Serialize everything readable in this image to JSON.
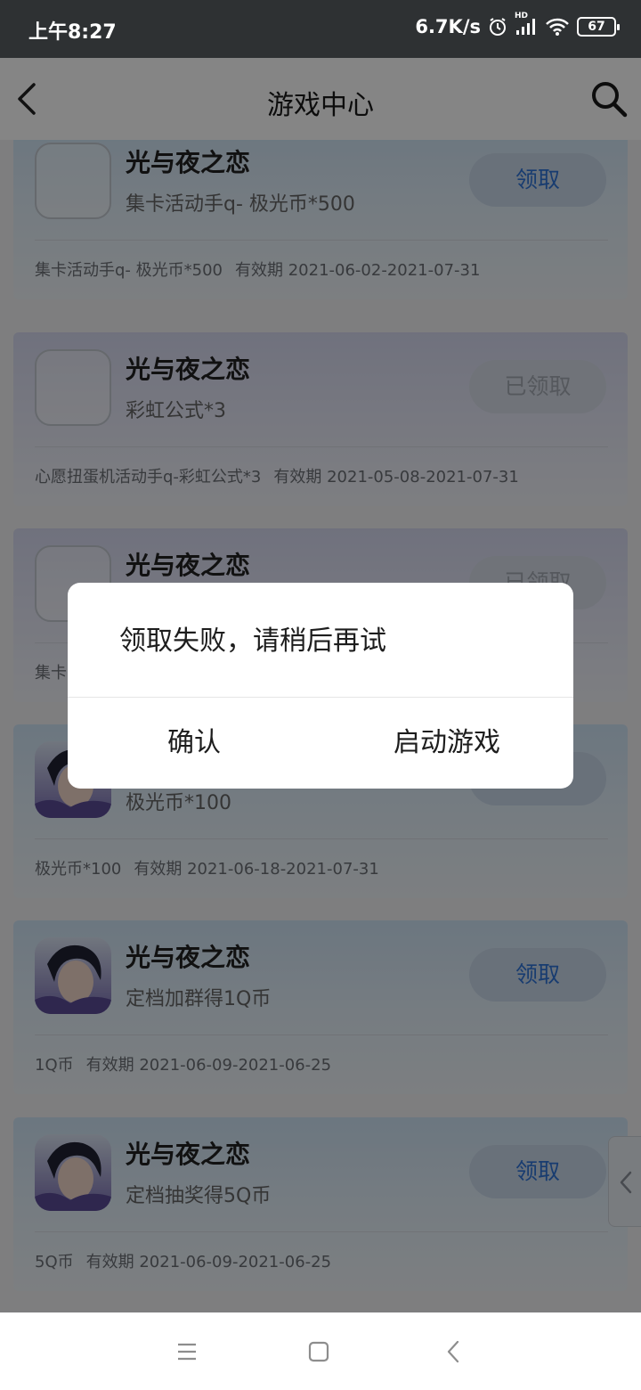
{
  "status_bar": {
    "time": "上午8:27",
    "net_speed": "6.7K/s",
    "battery": "67",
    "network_badge": "HD",
    "icons": [
      "alarm-icon",
      "signal-icon",
      "wifi-icon",
      "battery-icon"
    ]
  },
  "header": {
    "title": "游戏中心",
    "back_icon": "back-arrow-icon",
    "search_icon": "search-icon"
  },
  "cards": [
    {
      "title": "光与夜之恋",
      "subtitle": "集卡活动手q- 极光币*500",
      "button": "领取",
      "claimed": false,
      "icon_loaded": false,
      "desc": "集卡活动手q- 极光币*500",
      "validity": "有效期 2021-06-02-2021-07-31"
    },
    {
      "title": "光与夜之恋",
      "subtitle": "彩虹公式*3",
      "button": "已领取",
      "claimed": true,
      "icon_loaded": false,
      "desc": "心愿扭蛋机活动手q-彩虹公式*3",
      "validity": "有效期 2021-05-08-2021-07-31"
    },
    {
      "title": "光与夜之恋",
      "subtitle": "",
      "button": "已领取",
      "claimed": true,
      "icon_loaded": false,
      "desc": "集卡",
      "validity": ""
    },
    {
      "title": "",
      "subtitle": "极光币*100",
      "button": "领取",
      "claimed": false,
      "icon_loaded": true,
      "desc": "极光币*100",
      "validity": "有效期 2021-06-18-2021-07-31"
    },
    {
      "title": "光与夜之恋",
      "subtitle": "定档加群得1Q币",
      "button": "领取",
      "claimed": false,
      "icon_loaded": true,
      "desc": "1Q币",
      "validity": "有效期 2021-06-09-2021-06-25"
    },
    {
      "title": "光与夜之恋",
      "subtitle": "定档抽奖得5Q币",
      "button": "领取",
      "claimed": false,
      "icon_loaded": true,
      "desc": "5Q币",
      "validity": "有效期 2021-06-09-2021-06-25"
    }
  ],
  "dialog": {
    "message": "领取失败，请稍后再试",
    "confirm": "确认",
    "launch": "启动游戏"
  },
  "nav": {
    "icons": [
      "menu-icon",
      "home-icon",
      "back-icon"
    ]
  },
  "colors": {
    "status_bar": "#2e3133",
    "accent_blue": "#2f73d6",
    "overlay": "rgba(0,0,0,0.48)"
  }
}
